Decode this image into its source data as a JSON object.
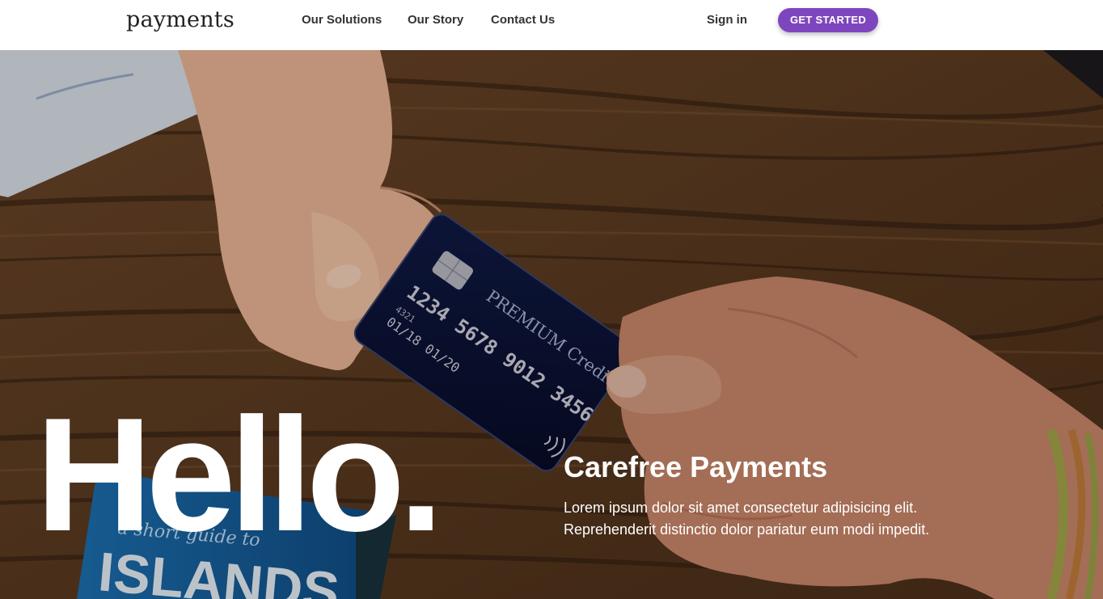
{
  "nav": {
    "logo": "payments",
    "links": [
      "Our Solutions",
      "Our Story",
      "Contact Us"
    ],
    "sign_in": "Sign in",
    "cta": "GET STARTED"
  },
  "hero": {
    "headline": "Hello.",
    "title": "Carefree Payments",
    "text_line1": "Lorem ipsum dolor sit amet consectetur adipisicing elit.",
    "text_line2": "Reprehenderit distinctio dolor pariatur eum modi impedit.",
    "image": {
      "card_brand": "PREMIUM Credit",
      "card_number": "1234 5678 9012 3456",
      "card_small": "4321",
      "card_dates": "01/18   01/20",
      "book_tagline": "a short guide to",
      "book_title": "ISLANDS"
    }
  },
  "colors": {
    "accent": "#7d46be",
    "nav_bg": "#ffffff",
    "hero_text": "#ffffff"
  }
}
